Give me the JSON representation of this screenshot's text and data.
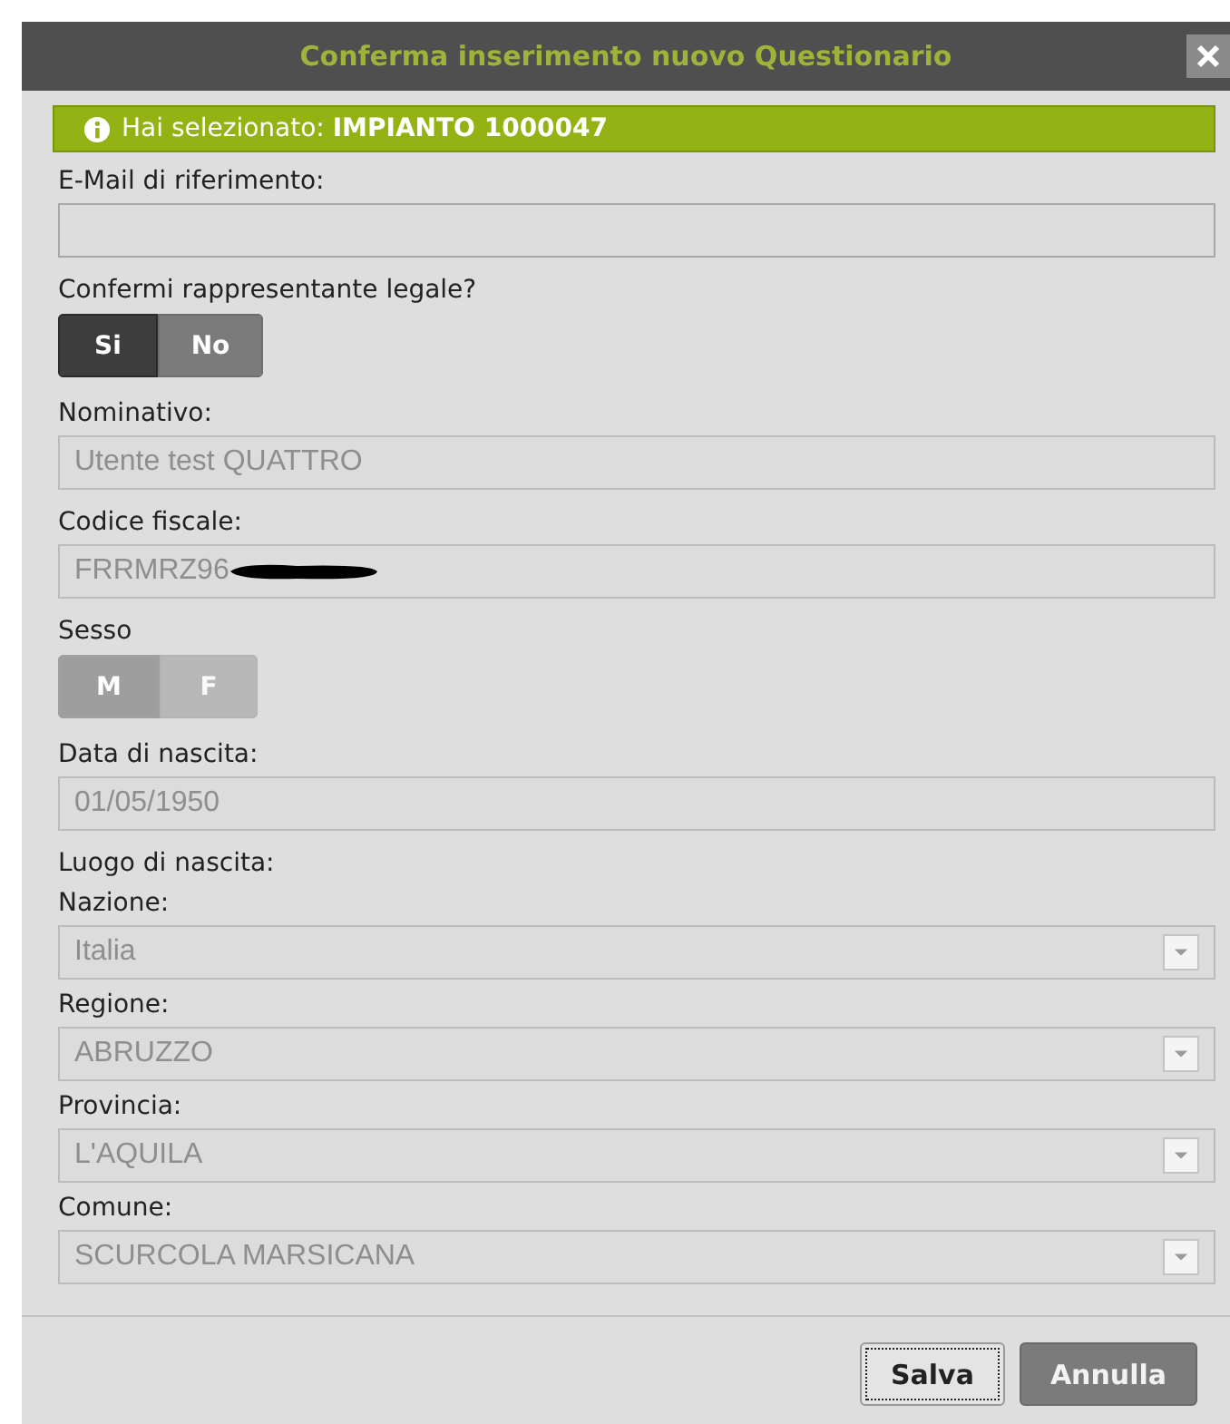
{
  "window": {
    "title": "Conferma inserimento nuovo Questionario"
  },
  "notice": {
    "text": "Hai selezionato: **IMPIANTO 1000047**"
  },
  "fields": [
    {
      "kind": "text",
      "label": "E-Mail di riferimento:",
      "disabled": false
    },
    {
      "kind": "toggle",
      "label": "Confermi rappresentante legale?",
      "disabled": false,
      "options": [
        {
          "label": "Si",
          "selected": true
        },
        {
          "label": "No",
          "selected": false
        }
      ]
    },
    {
      "kind": "text",
      "label": "Nominativo:",
      "value": "Utente test QUATTRO",
      "disabled": true
    },
    {
      "kind": "text",
      "label": "Codice fiscale:",
      "value": "FRRMRZ96",
      "disabled": true,
      "redacted": true
    },
    {
      "kind": "toggle",
      "label": "Sesso",
      "disabled": true,
      "options": [
        {
          "label": "M",
          "selected": true
        },
        {
          "label": "F",
          "selected": false
        }
      ]
    },
    {
      "kind": "text",
      "label": "Data di nascita:",
      "value": "01/05/1950",
      "disabled": true
    },
    {
      "kind": "heading",
      "label": "Luogo di nascita:"
    },
    {
      "kind": "select",
      "label": "Nazione:",
      "value": "Italia",
      "disabled": true
    },
    {
      "kind": "select",
      "label": "Regione:",
      "value": "ABRUZZO",
      "disabled": true
    },
    {
      "kind": "select",
      "label": "Provincia:",
      "value": "L'AQUILA",
      "disabled": true
    },
    {
      "kind": "select",
      "label": "Comune:",
      "value": "SCURCOLA MARSICANA",
      "disabled": true
    }
  ],
  "buttons": [
    {
      "label": "Salva",
      "kind": "secondary",
      "focused": true
    },
    {
      "label": "Annulla",
      "kind": "primary",
      "focused": false
    }
  ]
}
